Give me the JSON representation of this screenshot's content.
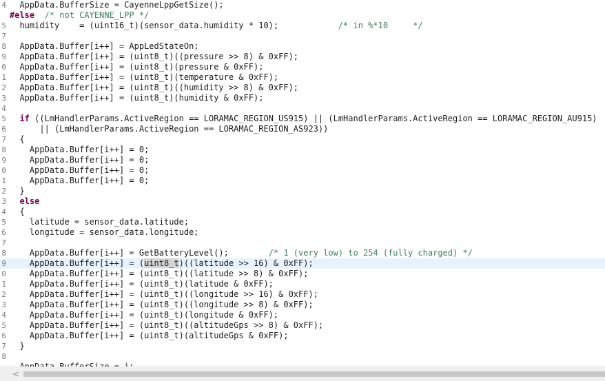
{
  "editor": {
    "lines": [
      {
        "n": "4",
        "segs": [
          {
            "t": "  AppData.BufferSize = CayenneLppGetSize();"
          }
        ]
      },
      {
        "n": "",
        "segs": [
          {
            "t": "#else",
            "c": "kw"
          },
          {
            "t": "  "
          },
          {
            "t": "/* not CAYENNE_LPP */",
            "c": "cm"
          }
        ]
      },
      {
        "n": "5",
        "segs": [
          {
            "t": "  humidity    = (uint16_t)(sensor_data.humidity * 10);            "
          },
          {
            "t": "/* in %*10     */",
            "c": "cm"
          }
        ]
      },
      {
        "n": "7",
        "segs": []
      },
      {
        "n": "8",
        "segs": [
          {
            "t": "  AppData.Buffer[i++] = AppLedStateOn;"
          }
        ]
      },
      {
        "n": "9",
        "segs": [
          {
            "t": "  AppData.Buffer[i++] = (uint8_t)((pressure >> 8) & 0xFF);"
          }
        ]
      },
      {
        "n": "0",
        "segs": [
          {
            "t": "  AppData.Buffer[i++] = (uint8_t)(pressure & 0xFF);"
          }
        ]
      },
      {
        "n": "1",
        "segs": [
          {
            "t": "  AppData.Buffer[i++] = (uint8_t)(temperature & 0xFF);"
          }
        ]
      },
      {
        "n": "2",
        "segs": [
          {
            "t": "  AppData.Buffer[i++] = (uint8_t)((humidity >> 8) & 0xFF);"
          }
        ]
      },
      {
        "n": "3",
        "segs": [
          {
            "t": "  AppData.Buffer[i++] = (uint8_t)(humidity & 0xFF);"
          }
        ]
      },
      {
        "n": "4",
        "segs": []
      },
      {
        "n": "5",
        "segs": [
          {
            "t": "  "
          },
          {
            "t": "if",
            "c": "kw"
          },
          {
            "t": " ((LmHandlerParams.ActiveRegion == LORAMAC_REGION_US915) || (LmHandlerParams.ActiveRegion == LORAMAC_REGION_AU915)"
          }
        ]
      },
      {
        "n": "6",
        "segs": [
          {
            "t": "      || (LmHandlerParams.ActiveRegion == LORAMAC_REGION_AS923))"
          }
        ]
      },
      {
        "n": "7",
        "segs": [
          {
            "t": "  {"
          }
        ]
      },
      {
        "n": "8",
        "segs": [
          {
            "t": "    AppData.Buffer[i++] = 0;"
          }
        ]
      },
      {
        "n": "9",
        "segs": [
          {
            "t": "    AppData.Buffer[i++] = 0;"
          }
        ]
      },
      {
        "n": "0",
        "segs": [
          {
            "t": "    AppData.Buffer[i++] = 0;"
          }
        ]
      },
      {
        "n": "1",
        "segs": [
          {
            "t": "    AppData.Buffer[i++] = 0;"
          }
        ]
      },
      {
        "n": "2",
        "segs": [
          {
            "t": "  }"
          }
        ]
      },
      {
        "n": "3",
        "segs": [
          {
            "t": "  "
          },
          {
            "t": "else",
            "c": "kw"
          }
        ]
      },
      {
        "n": "4",
        "segs": [
          {
            "t": "  {"
          }
        ]
      },
      {
        "n": "5",
        "segs": [
          {
            "t": "    latitude = sensor_data.latitude;"
          }
        ]
      },
      {
        "n": "6",
        "segs": [
          {
            "t": "    longitude = sensor_data.longitude;"
          }
        ]
      },
      {
        "n": "7",
        "segs": []
      },
      {
        "n": "8",
        "segs": [
          {
            "t": "    AppData.Buffer[i++] = GetBatteryLevel();        "
          },
          {
            "t": "/* 1 (very low) to 254 (fully charged) */",
            "c": "cm"
          }
        ]
      },
      {
        "n": "9",
        "current": true,
        "segs": [
          {
            "t": "    AppData.Buffer[i++] = ("
          },
          {
            "t": "uint8_t",
            "c": "mark"
          },
          {
            "t": ")((latitude >> 16) & 0xFF);"
          }
        ]
      },
      {
        "n": "0",
        "segs": [
          {
            "t": "    AppData.Buffer[i++] = (uint8_t)((latitude >> 8) & 0xFF);"
          }
        ]
      },
      {
        "n": "1",
        "segs": [
          {
            "t": "    AppData.Buffer[i++] = (uint8_t)(latitude & 0xFF);"
          }
        ]
      },
      {
        "n": "2",
        "segs": [
          {
            "t": "    AppData.Buffer[i++] = (uint8_t)((longitude >> 16) & 0xFF);"
          }
        ]
      },
      {
        "n": "3",
        "segs": [
          {
            "t": "    AppData.Buffer[i++] = (uint8_t)((longitude >> 8) & 0xFF);"
          }
        ]
      },
      {
        "n": "4",
        "segs": [
          {
            "t": "    AppData.Buffer[i++] = (uint8_t)(longitude & 0xFF);"
          }
        ]
      },
      {
        "n": "5",
        "segs": [
          {
            "t": "    AppData.Buffer[i++] = (uint8_t)((altitudeGps >> 8) & 0xFF);"
          }
        ]
      },
      {
        "n": "6",
        "segs": [
          {
            "t": "    AppData.Buffer[i++] = (uint8_t)(altitudeGps & 0xFF);"
          }
        ]
      },
      {
        "n": "7",
        "segs": [
          {
            "t": "  }"
          }
        ]
      },
      {
        "n": "8",
        "segs": []
      },
      {
        "n": "",
        "segs": [
          {
            "t": "  AppData.BufferSize = i;"
          }
        ]
      }
    ]
  },
  "scrollbar": {
    "left_arrow_icon": "chevron-left-icon",
    "left_arrow_glyph": "<"
  },
  "colors": {
    "keyword": "#7f0055",
    "comment": "#3f7f5f",
    "current_line": "#e8f2fe",
    "occurrence_mark": "#d4d4d4"
  }
}
